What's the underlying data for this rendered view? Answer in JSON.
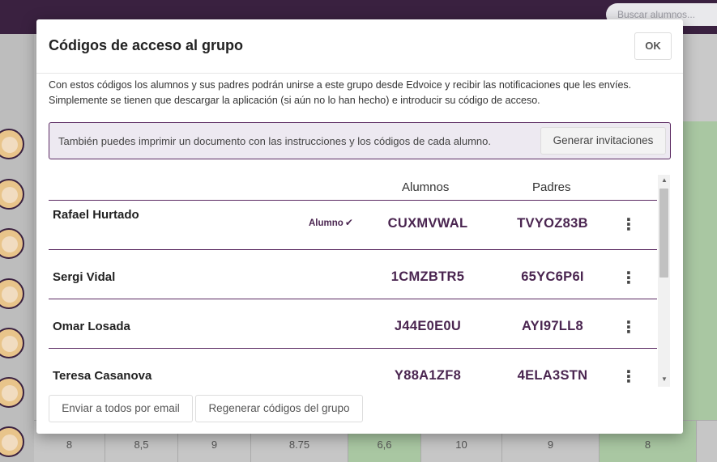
{
  "background": {
    "search_placeholder": "Buscar alumnos...",
    "last_row_values": [
      "8",
      "8,5",
      "9",
      "8.75",
      "6,6",
      "10",
      "9",
      "8"
    ]
  },
  "modal": {
    "title": "Códigos de acceso al grupo",
    "ok_label": "OK",
    "description": "Con estos códigos los alumnos y sus padres podrán unirse a este grupo desde Edvoice y recibir las notificaciones que les envíes. Simplemente se tienen que descargar la aplicación (si aún no lo han hecho) e introducir su código de acceso.",
    "info_text": "También puedes imprimir un documento con las instrucciones y los códigos de cada alumno.",
    "generate_label": "Generar invitaciones",
    "table": {
      "headers": {
        "students": "Alumnos",
        "parents": "Padres"
      },
      "rows": [
        {
          "name": "Rafael Hurtado",
          "badge": "Alumno",
          "badge_icon": "check-icon",
          "student_code": "CUXMVWAL",
          "parent_code": "TVYOZ83B"
        },
        {
          "name": "Sergi Vidal",
          "badge": "",
          "student_code": "1CMZBTR5",
          "parent_code": "65YC6P6I"
        },
        {
          "name": "Omar Losada",
          "badge": "",
          "student_code": "J44E0E0U",
          "parent_code": "AYI97LL8"
        },
        {
          "name": "Teresa Casanova",
          "badge": "",
          "student_code": "Y88A1ZF8",
          "parent_code": "4ELA3STN"
        }
      ]
    },
    "footer": {
      "email_all_label": "Enviar a todos por email",
      "regenerate_label": "Regenerar códigos del grupo"
    }
  },
  "colors": {
    "brand": "#3a2140",
    "accent": "#5b2a62",
    "code_text": "#4a2550"
  }
}
